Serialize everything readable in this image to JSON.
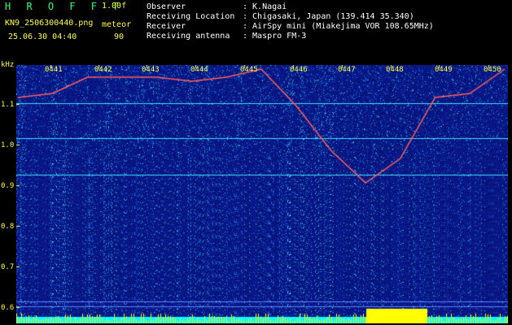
{
  "header": {
    "app_title": "H R O F F T",
    "version": "1.00f",
    "filename": "KN9_2506300440.png",
    "meteor_label": "meteor",
    "datetime": "25.06.30 04:40",
    "count": "90"
  },
  "info": [
    {
      "key": "Observer",
      "value": ": K.Nagai"
    },
    {
      "key": "Receiving Location",
      "value": ": Chigasaki, Japan (139.414 35.340)"
    },
    {
      "key": "Receiver",
      "value": ": AirSpy mini (Miakejima VOR 108.65MHz)"
    },
    {
      "key": "Receiving antenna",
      "value": ": Maspro FM-3"
    }
  ],
  "colors": {
    "label_yellow": "#ffff33",
    "title_green": "#33ff66",
    "background": "#000000",
    "spectrum_base": "#0a1a8c",
    "trace": "#ff6060",
    "bottom_bar": "#00ffff",
    "highlight_bar": "#ffff00"
  },
  "chart_data": {
    "type": "spectrogram",
    "y_unit": "kHz",
    "y_ticks": [
      "1.1",
      "1.0",
      "0.9",
      "0.8",
      "0.7",
      "0.6"
    ],
    "x_ticks": [
      "0441",
      "0442",
      "0443",
      "0444",
      "0445",
      "0446",
      "0447",
      "0448",
      "0449",
      "0450"
    ],
    "trace_points": [
      {
        "x": "04:40",
        "y": 1.12
      },
      {
        "x": "04:41",
        "y": 1.13
      },
      {
        "x": "04:41:30",
        "y": 1.17
      },
      {
        "x": "04:42",
        "y": 1.17
      },
      {
        "x": "04:43",
        "y": 1.17
      },
      {
        "x": "04:44",
        "y": 1.16
      },
      {
        "x": "04:45",
        "y": 1.17
      },
      {
        "x": "04:46",
        "y": 1.19
      },
      {
        "x": "04:47",
        "y": 1.1
      },
      {
        "x": "04:47:30",
        "y": 0.99
      },
      {
        "x": "04:48",
        "y": 0.91
      },
      {
        "x": "04:48:30",
        "y": 0.97
      },
      {
        "x": "04:49",
        "y": 1.12
      },
      {
        "x": "04:49:30",
        "y": 1.13
      },
      {
        "x": "04:50",
        "y": 1.19
      }
    ]
  }
}
